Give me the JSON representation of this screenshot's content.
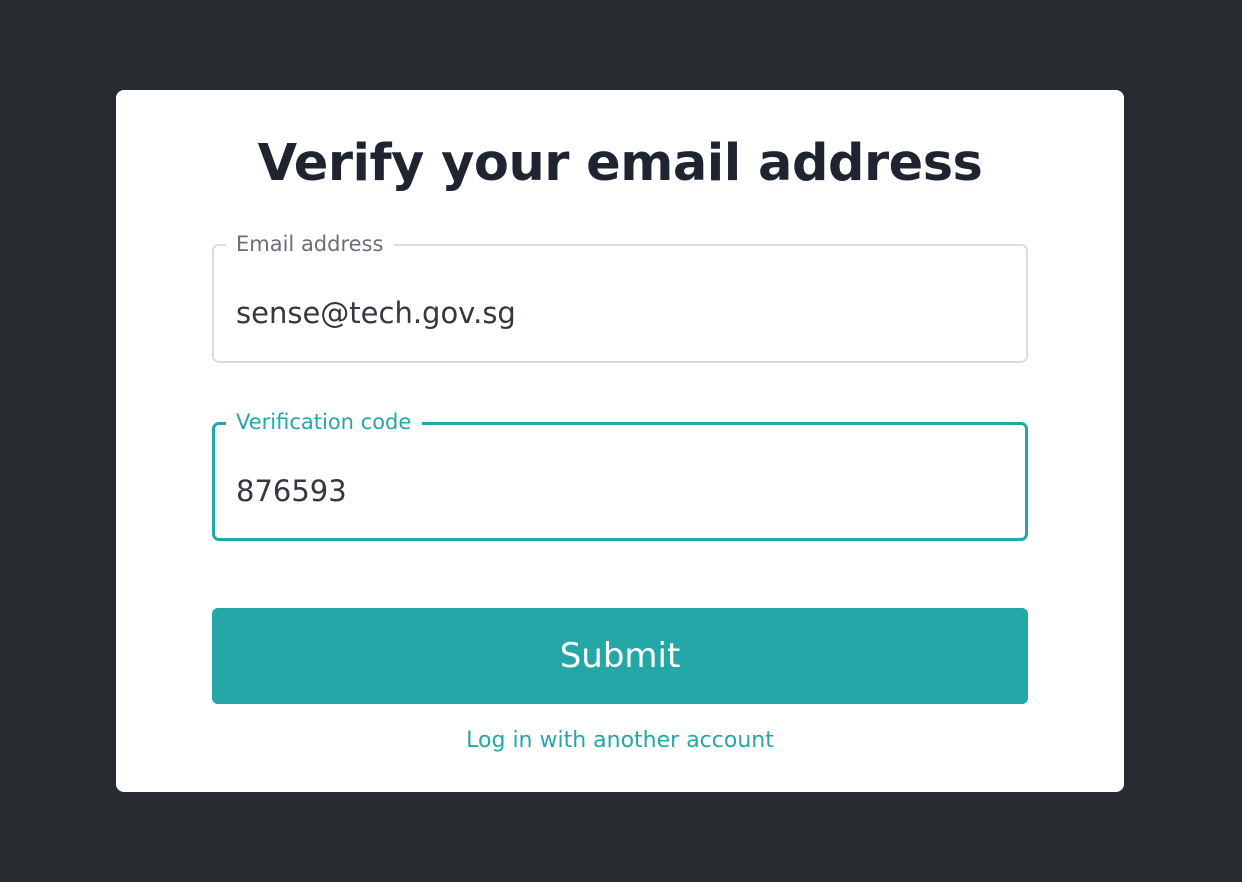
{
  "page": {
    "title": "Verify your email address"
  },
  "form": {
    "email": {
      "label": "Email address",
      "value": "sense@tech.gov.sg"
    },
    "verification_code": {
      "label": "Verification code",
      "value": "876593"
    },
    "submit_label": "Submit",
    "alternate_login_label": "Log in with another account"
  },
  "colors": {
    "background": "#272b30",
    "card": "#ffffff",
    "accent": "#24a7a6",
    "title_text": "#1f2430",
    "input_border": "#dcdcdc"
  }
}
